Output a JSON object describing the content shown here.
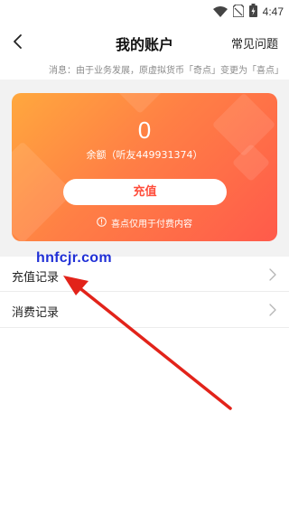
{
  "status_bar": {
    "time": "4:47"
  },
  "header": {
    "title": "我的账户",
    "faq_label": "常见问题"
  },
  "notice": {
    "text": "消息：由于业务发展，原虚拟货币「奇点」变更为「喜点」"
  },
  "balance_card": {
    "amount": "0",
    "caption": "余额（听友449931374）",
    "recharge_label": "充值",
    "note": "喜点仅用于付费内容"
  },
  "list": {
    "items": [
      {
        "label": "充值记录"
      },
      {
        "label": "消费记录"
      }
    ]
  },
  "watermark": {
    "text": "hnfcjr.com"
  },
  "colors": {
    "accent_red": "#ff4e3c",
    "card_gradient_start": "#ffa83e",
    "card_gradient_end": "#ff5a4b",
    "watermark_blue": "#1f2fd6",
    "arrow_red": "#e2231a"
  }
}
